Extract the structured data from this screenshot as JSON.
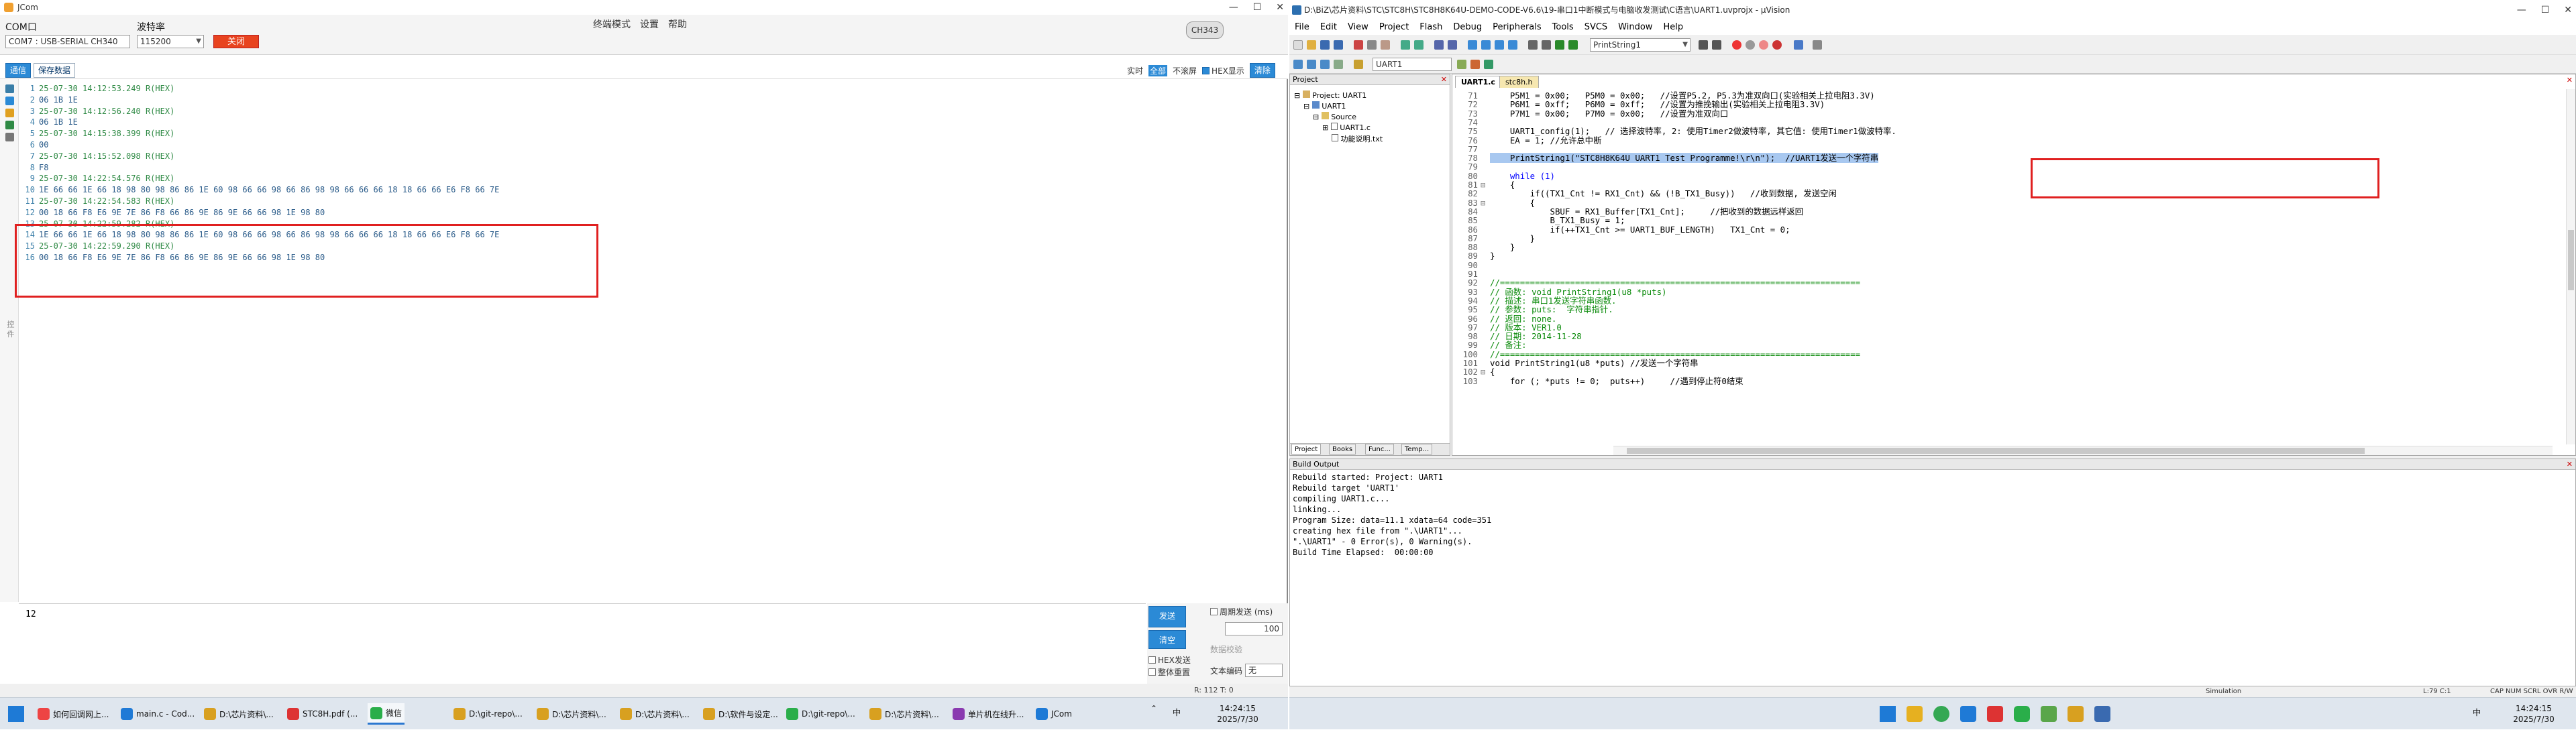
{
  "colors": {
    "accent_blue": "#2b8ad6",
    "close_red": "#e8431f",
    "highlight_box": "#e02020",
    "comment_green": "#0a8a0a",
    "keyword_blue": "#0000ff"
  },
  "jcom": {
    "title": "JCom",
    "port_label": "COM口",
    "port_value": "COM7 : USB-SERIAL CH340",
    "baud_label": "波特率",
    "baud_value": "115200",
    "close_btn": "关闭",
    "menu": [
      "终端模式",
      "设置",
      "帮助"
    ],
    "chip_badge": "CH343",
    "tabs": [
      "通信",
      "保存数据"
    ],
    "opts": {
      "realtime": "实时",
      "all": "全部",
      "no_scroll": "不滚屏",
      "hex_display": "HEX显示",
      "clear": "清除"
    },
    "side_label": "控 件",
    "recv_lines": [
      {
        "n": "1",
        "text": "25-07-30 14:12:53.249 R(HEX)",
        "kind": "ts"
      },
      {
        "n": "2",
        "text": "06 1B 1E",
        "kind": "hx"
      },
      {
        "n": "3",
        "text": "25-07-30 14:12:56.240 R(HEX)",
        "kind": "ts"
      },
      {
        "n": "4",
        "text": "06 1B 1E",
        "kind": "hx"
      },
      {
        "n": "5",
        "text": "25-07-30 14:15:38.399 R(HEX)",
        "kind": "ts"
      },
      {
        "n": "6",
        "text": "00",
        "kind": "hx"
      },
      {
        "n": "7",
        "text": "25-07-30 14:15:52.098 R(HEX)",
        "kind": "ts"
      },
      {
        "n": "8",
        "text": "F8",
        "kind": "hx"
      },
      {
        "n": "9",
        "text": "25-07-30 14:22:54.576 R(HEX)",
        "kind": "ts"
      },
      {
        "n": "10",
        "text": "1E 66 66 1E 66 18 98 80 98 86 86 1E 60 98 66 66 98 66 86 98 98 66 66 66 18 18 66 66 E6 F8 66 7E",
        "kind": "hx"
      },
      {
        "n": "11",
        "text": "25-07-30 14:22:54.583 R(HEX)",
        "kind": "ts"
      },
      {
        "n": "12",
        "text": "00 18 66 F8 E6 9E 7E 86 F8 66 86 9E 86 9E 66 66 98 1E 98 80",
        "kind": "hx"
      },
      {
        "n": "13",
        "text": "25-07-30 14:22:59.282 R(HEX)",
        "kind": "ts"
      },
      {
        "n": "14",
        "text": "1E 66 66 1E 66 18 98 80 98 86 86 1E 60 98 66 66 98 66 86 98 98 66 66 66 18 18 66 66 E6 F8 66 7E",
        "kind": "hx"
      },
      {
        "n": "15",
        "text": "25-07-30 14:22:59.290 R(HEX)",
        "kind": "ts"
      },
      {
        "n": "16",
        "text": "00 18 66 F8 E6 9E 7E 86 F8 66 86 9E 86 9E 66 66 98 1E 98 80",
        "kind": "hx"
      }
    ],
    "send_text": "12",
    "send_btn": "发送",
    "clear_btn": "清空",
    "hex_send": "HEX发送",
    "clear_after": "整体重置",
    "periodic_label": "周期发送 (ms)",
    "periodic_value": "100",
    "data_check": "数据校验",
    "text_encoding_label": "文本编码",
    "text_encoding_value": "无",
    "status": "R: 112     T: 0"
  },
  "uv": {
    "title": "D:\\BiZ\\芯片资料\\STC\\STC8H\\STC8H8K64U-DEMO-CODE-V6.6\\19-串口1中断模式与电脑收发测试\\C语言\\UART1.uvprojx - µVision",
    "menu": [
      "File",
      "Edit",
      "View",
      "Project",
      "Flash",
      "Debug",
      "Peripherals",
      "Tools",
      "SVCS",
      "Window",
      "Help"
    ],
    "toolbar_combo": "PrintString1",
    "target_combo": "UART1",
    "project_panel_title": "Project",
    "tree": [
      "Project: UART1",
      "UART1",
      "Source",
      "UART1.c",
      "功能说明.txt"
    ],
    "panel_tabs": [
      "Project",
      "Books",
      "Func...",
      "Temp..."
    ],
    "file_tabs": [
      "UART1.c",
      "stc8h.h"
    ],
    "code_lines": [
      {
        "n": "71",
        "f": "",
        "text": "    P5M1 = 0x00;   P5M0 = 0x00;   //设置P5.2, P5.3为准双向口(实验相关上拉电阻3.3V)",
        "c": "mixed"
      },
      {
        "n": "72",
        "f": "",
        "text": "    P6M1 = 0xff;   P6M0 = 0xff;   //设置为推挽输出(实验相关上拉电阻3.3V)",
        "c": "mixed"
      },
      {
        "n": "73",
        "f": "",
        "text": "    P7M1 = 0x00;   P7M0 = 0x00;   //设置为准双向口",
        "c": "mixed"
      },
      {
        "n": "74",
        "f": "",
        "text": "",
        "c": ""
      },
      {
        "n": "75",
        "f": "",
        "text": "    UART1_config(1);   // 选择波特率, 2: 使用Timer2做波特率, 其它值: 使用Timer1做波特率.",
        "c": "mixed"
      },
      {
        "n": "76",
        "f": "",
        "text": "    EA = 1; //允许总中断",
        "c": "mixed"
      },
      {
        "n": "77",
        "f": "",
        "text": "",
        "c": ""
      },
      {
        "n": "78",
        "f": "",
        "text": "    PrintString1(\"STC8H8K64U UART1 Test Programme!\\r\\n\");  //UART1发送一个字符串",
        "c": "hl"
      },
      {
        "n": "79",
        "f": "",
        "text": "",
        "c": ""
      },
      {
        "n": "80",
        "f": "",
        "text": "    while (1)",
        "c": "kw"
      },
      {
        "n": "81",
        "f": "⊟",
        "text": "    {",
        "c": ""
      },
      {
        "n": "82",
        "f": "",
        "text": "        if((TX1_Cnt != RX1_Cnt) && (!B_TX1_Busy))   //收到数据, 发送空闲",
        "c": "mixed"
      },
      {
        "n": "83",
        "f": "⊟",
        "text": "        {",
        "c": ""
      },
      {
        "n": "84",
        "f": "",
        "text": "            SBUF = RX1_Buffer[TX1_Cnt];     //把收到的数据远样返回",
        "c": "mixed"
      },
      {
        "n": "85",
        "f": "",
        "text": "            B_TX1_Busy = 1;",
        "c": ""
      },
      {
        "n": "86",
        "f": "",
        "text": "            if(++TX1_Cnt >= UART1_BUF_LENGTH)   TX1_Cnt = 0;",
        "c": ""
      },
      {
        "n": "87",
        "f": "",
        "text": "        }",
        "c": ""
      },
      {
        "n": "88",
        "f": "",
        "text": "    }",
        "c": ""
      },
      {
        "n": "89",
        "f": "",
        "text": "}",
        "c": ""
      },
      {
        "n": "90",
        "f": "",
        "text": "",
        "c": ""
      },
      {
        "n": "91",
        "f": "",
        "text": "",
        "c": ""
      },
      {
        "n": "92",
        "f": "",
        "text": "//========================================================================",
        "c": "cmt"
      },
      {
        "n": "93",
        "f": "",
        "text": "// 函数: void PrintString1(u8 *puts)",
        "c": "cmt"
      },
      {
        "n": "94",
        "f": "",
        "text": "// 描述: 串口1发送字符串函数.",
        "c": "cmt"
      },
      {
        "n": "95",
        "f": "",
        "text": "// 参数: puts:  字符串指针.",
        "c": "cmt"
      },
      {
        "n": "96",
        "f": "",
        "text": "// 返回: none.",
        "c": "cmt"
      },
      {
        "n": "97",
        "f": "",
        "text": "// 版本: VER1.0",
        "c": "cmt"
      },
      {
        "n": "98",
        "f": "",
        "text": "// 日期: 2014-11-28",
        "c": "cmt"
      },
      {
        "n": "99",
        "f": "",
        "text": "// 备注:",
        "c": "cmt"
      },
      {
        "n": "100",
        "f": "",
        "text": "//========================================================================",
        "c": "cmt"
      },
      {
        "n": "101",
        "f": "",
        "text": "void PrintString1(u8 *puts) //发送一个字符串",
        "c": "mixed"
      },
      {
        "n": "102",
        "f": "⊟",
        "text": "{",
        "c": ""
      },
      {
        "n": "103",
        "f": "",
        "text": "    for (; *puts != 0;  puts++)     //遇到停止符0结束",
        "c": "mixed"
      }
    ],
    "build_title": "Build Output",
    "build_lines": [
      "Rebuild started: Project: UART1",
      "Rebuild target 'UART1'",
      "compiling UART1.c...",
      "linking...",
      "Program Size: data=11.1 xdata=64 code=351",
      "creating hex file from \".\\UART1\"...",
      "\".\\UART1\" - 0 Error(s), 0 Warning(s).",
      "Build Time Elapsed:  00:00:00"
    ],
    "status_mode": "Simulation",
    "status_pos": "L:79 C:1",
    "status_caps": "CAP  NUM  SCRL  OVR  R/W"
  },
  "taskbar_left": {
    "items": [
      "如何回调网上...",
      "main.c - Cod...",
      "D:\\芯片资料\\...",
      "STC8H.pdf (...",
      "微信",
      "D:\\git-repo\\...",
      "D:\\芯片资料\\...",
      "D:\\芯片资料\\...",
      "D:\\软件与设定...",
      "D:\\git-repo\\...",
      "D:\\芯片资料\\...",
      "单片机在线升...",
      "JCom"
    ],
    "lang": "中",
    "time": "14:24:15",
    "date": "2025/7/30"
  },
  "taskbar_right": {
    "lang": "中",
    "time": "14:24:15",
    "date": "2025/7/30"
  }
}
